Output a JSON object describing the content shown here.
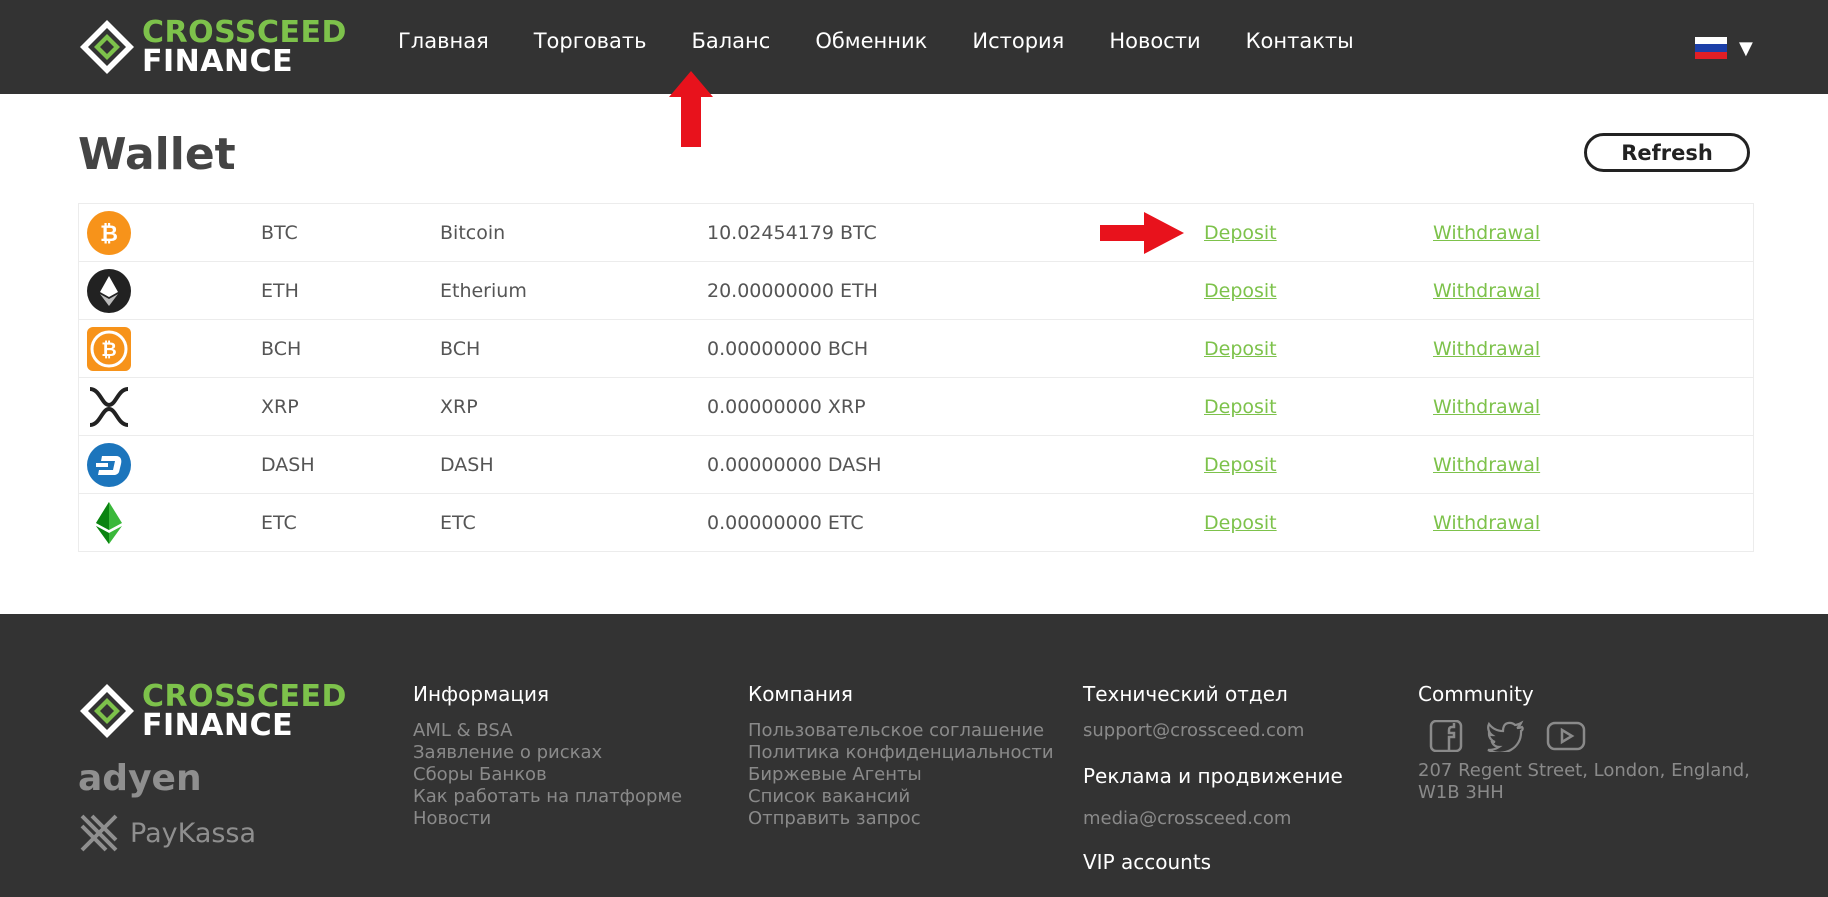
{
  "header": {
    "logo_line1": "CROSSCEED",
    "logo_line2": "FINANCE",
    "nav": [
      "Главная",
      "Торговать",
      "Баланс",
      "Обменник",
      "История",
      "Новости",
      "Контакты"
    ],
    "language": "ru"
  },
  "main": {
    "title": "Wallet",
    "refresh_label": "Refresh",
    "rows": [
      {
        "icon": "bitcoin-icon",
        "code": "BTC",
        "name": "Bitcoin",
        "balance": "10.02454179 BTC",
        "deposit": "Deposit",
        "withdrawal": "Withdrawal"
      },
      {
        "icon": "ethereum-icon",
        "code": "ETH",
        "name": "Etherium",
        "balance": "20.00000000 ETH",
        "deposit": "Deposit",
        "withdrawal": "Withdrawal"
      },
      {
        "icon": "bitcoin-cash-icon",
        "code": "BCH",
        "name": "BCH",
        "balance": "0.00000000 BCH",
        "deposit": "Deposit",
        "withdrawal": "Withdrawal"
      },
      {
        "icon": "xrp-icon",
        "code": "XRP",
        "name": "XRP",
        "balance": "0.00000000 XRP",
        "deposit": "Deposit",
        "withdrawal": "Withdrawal"
      },
      {
        "icon": "dash-icon",
        "code": "DASH",
        "name": "DASH",
        "balance": "0.00000000 DASH",
        "deposit": "Deposit",
        "withdrawal": "Withdrawal"
      },
      {
        "icon": "ethereum-classic-icon",
        "code": "ETC",
        "name": "ETC",
        "balance": "0.00000000 ETC",
        "deposit": "Deposit",
        "withdrawal": "Withdrawal"
      }
    ]
  },
  "footer": {
    "logo_line1": "CROSSCEED",
    "logo_line2": "FINANCE",
    "partners": [
      "adyen",
      "PayKassa"
    ],
    "info": {
      "title": "Информация",
      "links": [
        "AML & BSA",
        "Заявление о рисках",
        "Сборы Банков",
        "Как работать на платформе",
        "Новости"
      ]
    },
    "company": {
      "title": "Компания",
      "links": [
        "Пользовательское соглашение",
        "Политика конфиденциальности",
        "Биржевые Агенты",
        "Список вакансий",
        "Отправить запрос"
      ]
    },
    "tech": {
      "title": "Технический отдел",
      "email": "support@crossceed.com",
      "ads_title": "Реклама и продвижение",
      "ads_email": "media@crossceed.com",
      "vip_title": "VIP accounts"
    },
    "community": {
      "title": "Community",
      "icons": [
        "facebook-icon",
        "twitter-icon",
        "youtube-icon"
      ],
      "address": [
        "207 Regent Street, London, England,",
        "W1B 3HH"
      ]
    }
  },
  "colors": {
    "dark": "#333333",
    "green": "#7dc24b",
    "arrow": "#e8121c"
  }
}
